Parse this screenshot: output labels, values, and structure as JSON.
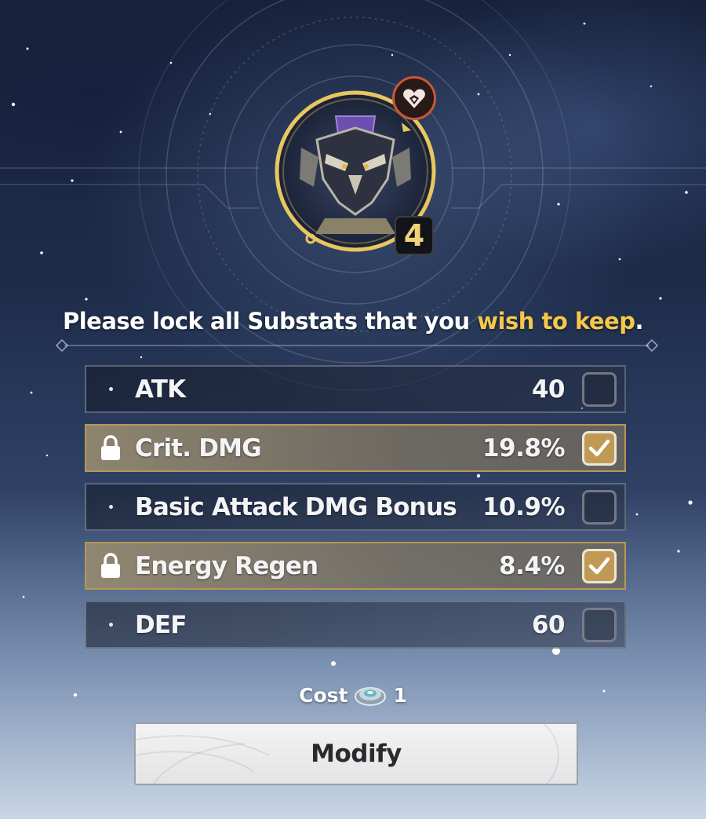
{
  "artifact": {
    "level": "4",
    "set_icon": "heart-set-icon",
    "artifact_icon": "echo-mask-icon"
  },
  "instruction": {
    "prefix": "Please lock all Substats that you ",
    "highlight": "wish to keep",
    "suffix": "."
  },
  "substats": [
    {
      "name": "ATK",
      "value": "40",
      "locked": false
    },
    {
      "name": "Crit. DMG",
      "value": "19.8%",
      "locked": true
    },
    {
      "name": "Basic Attack DMG Bonus",
      "value": "10.9%",
      "locked": false
    },
    {
      "name": "Energy Regen",
      "value": "8.4%",
      "locked": true
    },
    {
      "name": "DEF",
      "value": "60",
      "locked": false
    }
  ],
  "cost": {
    "label": "Cost",
    "icon": "tuner-material-icon",
    "amount": "1"
  },
  "modify_button": {
    "label": "Modify"
  },
  "colors": {
    "highlight": "#f5c84a",
    "locked_row": "#968a70",
    "checkbox_checked": "#c09a55",
    "set_icon_ring": "#c9573a",
    "artifact_ring": "#e8c660"
  }
}
